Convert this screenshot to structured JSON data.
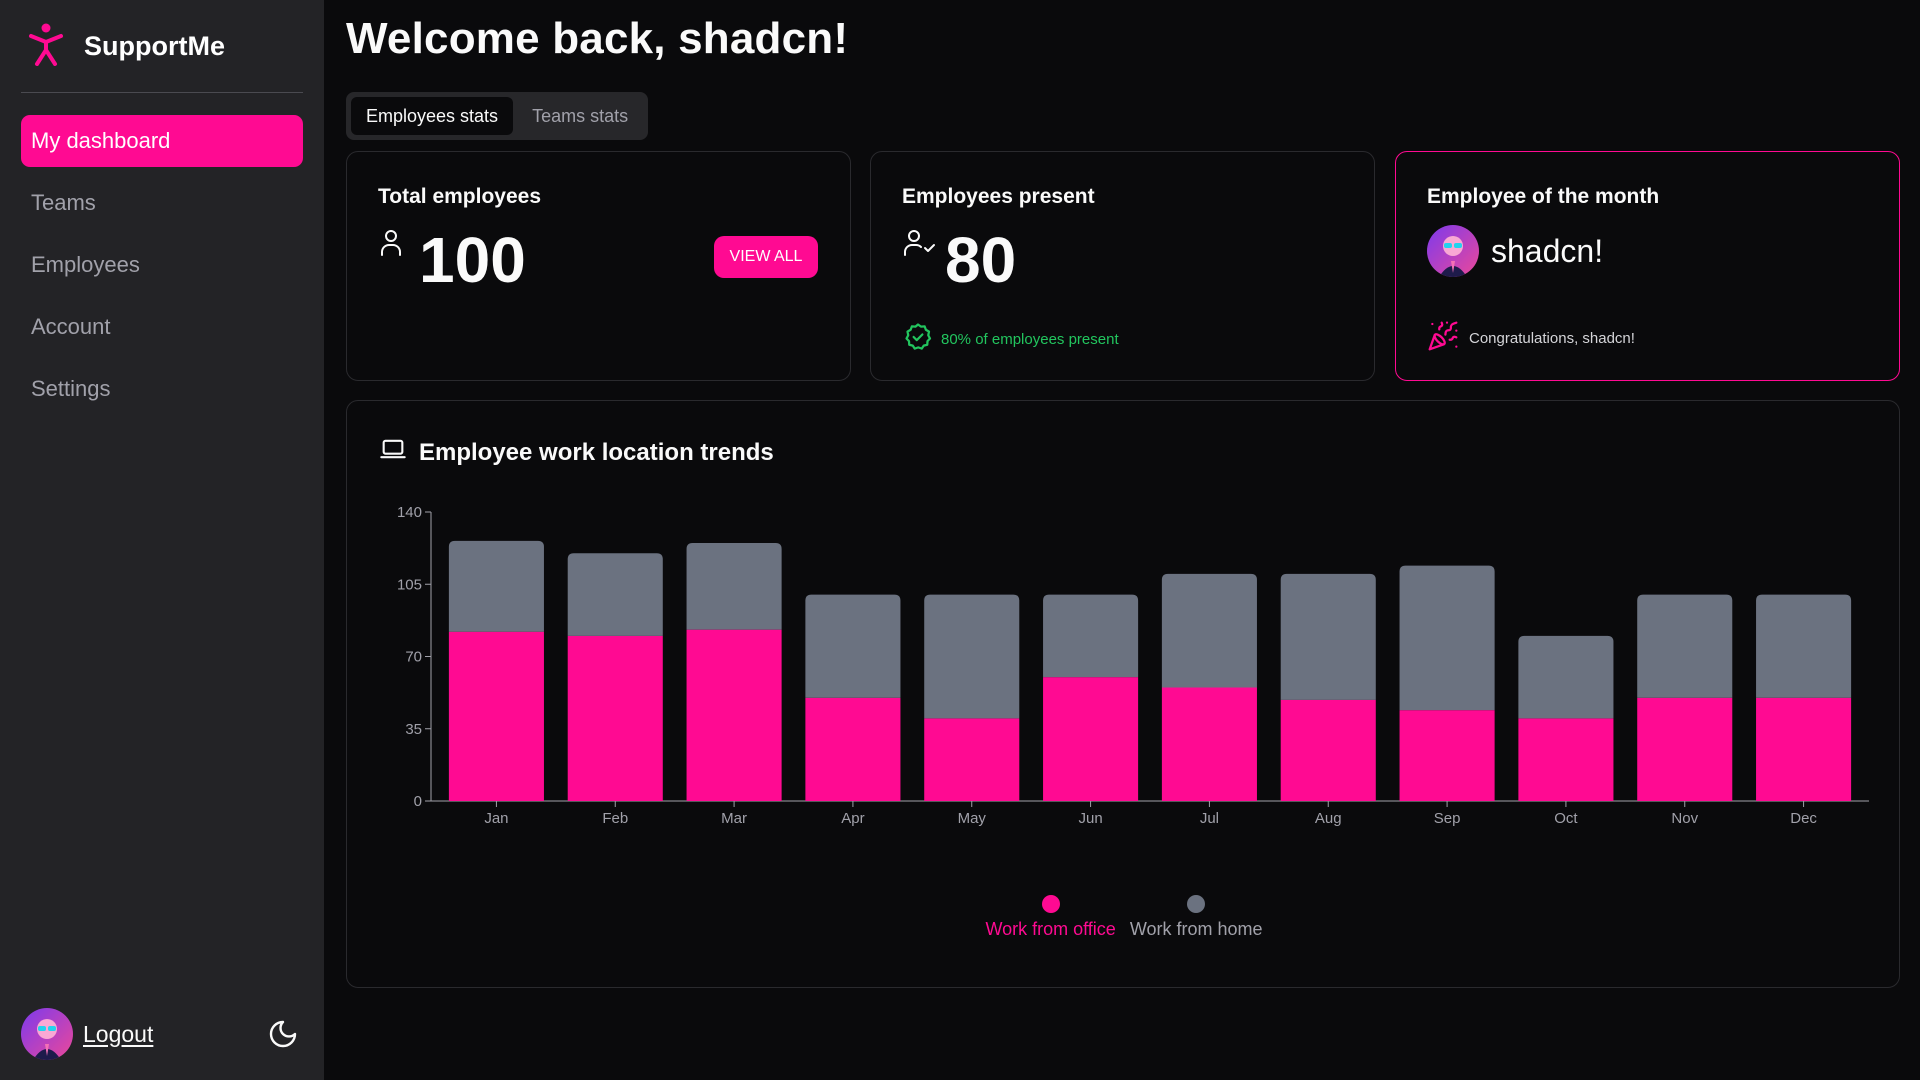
{
  "app": {
    "name": "SupportMe"
  },
  "sidebar": {
    "items": [
      {
        "label": "My dashboard",
        "active": true
      },
      {
        "label": "Teams",
        "active": false
      },
      {
        "label": "Employees",
        "active": false
      },
      {
        "label": "Account",
        "active": false
      },
      {
        "label": "Settings",
        "active": false
      }
    ],
    "logout_label": "Logout"
  },
  "page": {
    "title": "Welcome back, shadcn!"
  },
  "tabs": [
    {
      "label": "Employees stats",
      "active": true
    },
    {
      "label": "Teams stats",
      "active": false
    }
  ],
  "cards": {
    "total": {
      "title": "Total employees",
      "value": "100",
      "button_label": "VIEW ALL"
    },
    "present": {
      "title": "Employees present",
      "value": "80",
      "note": "80% of employees present"
    },
    "eom": {
      "title": "Employee of the month",
      "name": "shadcn!",
      "congrats": "Congratulations, shadcn!"
    }
  },
  "chart_card": {
    "title": "Employee work location trends"
  },
  "colors": {
    "accent": "#ff0a92",
    "home": "#6b7280",
    "success": "#22c55e",
    "sidebar": "#232326",
    "background": "#0a0a0c"
  },
  "icons": {
    "brand": "person-icon",
    "laptop": "laptop-icon",
    "user": "user-icon",
    "user_check": "user-check-icon",
    "badge_check": "badge-check-icon",
    "party": "party-popper-icon",
    "moon": "moon-icon"
  },
  "chart_data": {
    "type": "bar",
    "stacked": true,
    "categories": [
      "Jan",
      "Feb",
      "Mar",
      "Apr",
      "May",
      "Jun",
      "Jul",
      "Aug",
      "Sep",
      "Oct",
      "Nov",
      "Dec"
    ],
    "series": [
      {
        "name": "Work from office",
        "color": "#ff0a92",
        "values": [
          82,
          80,
          83,
          50,
          40,
          60,
          55,
          49,
          44,
          40,
          50,
          50
        ]
      },
      {
        "name": "Work from home",
        "color": "#6b7280",
        "values": [
          44,
          40,
          42,
          50,
          60,
          40,
          55,
          61,
          70,
          40,
          50,
          50
        ]
      }
    ],
    "yticks": [
      0,
      35,
      70,
      105,
      140
    ],
    "ylim": [
      0,
      140
    ],
    "legend": "bottom-center"
  }
}
